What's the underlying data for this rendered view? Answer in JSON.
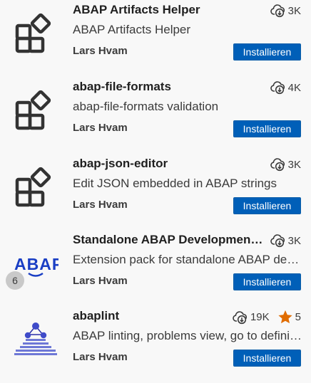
{
  "colors": {
    "install_bg": "#005fb8",
    "star": "#e06c00",
    "text": "#3b3b3b"
  },
  "extensions": [
    {
      "name": "ABAP Artifacts Helper",
      "description": "ABAP Artifacts Helper",
      "publisher": "Lars Hvam",
      "downloads": "3K",
      "install_label": "Installieren",
      "icon": "extensions-placeholder-icon"
    },
    {
      "name": "abap-file-formats",
      "description": "abap-file-formats validation",
      "publisher": "Lars Hvam",
      "downloads": "4K",
      "install_label": "Installieren",
      "icon": "extensions-placeholder-icon"
    },
    {
      "name": "abap-json-editor",
      "description": "Edit JSON embedded in ABAP strings",
      "publisher": "Lars Hvam",
      "downloads": "3K",
      "install_label": "Installieren",
      "icon": "extensions-placeholder-icon"
    },
    {
      "name": "Standalone ABAP Development Extension Pack",
      "description": "Extension pack for standalone ABAP development",
      "publisher": "Lars Hvam",
      "downloads": "3K",
      "install_label": "Installieren",
      "icon": "abap-logo-icon",
      "badge": "6"
    },
    {
      "name": "abaplint",
      "description": "ABAP linting, problems view, go to definition",
      "publisher": "Lars Hvam",
      "downloads": "19K",
      "rating": "5",
      "install_label": "Installieren",
      "icon": "abaplint-logo-icon"
    }
  ]
}
